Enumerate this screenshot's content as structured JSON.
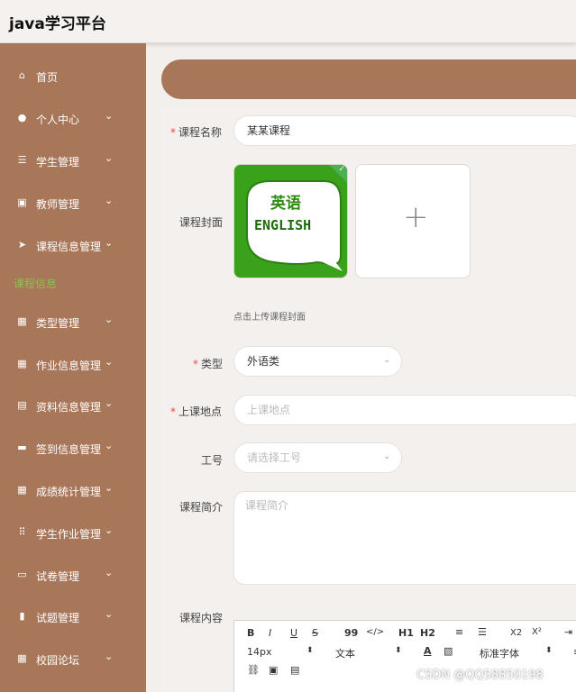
{
  "app": {
    "title": "java学习平台"
  },
  "sidebar": {
    "items": [
      {
        "label": "首页",
        "icon": "home-icon",
        "chevron": false
      },
      {
        "label": "个人中心",
        "icon": "user-icon",
        "chevron": true
      },
      {
        "label": "学生管理",
        "icon": "list-icon",
        "chevron": true
      },
      {
        "label": "教师管理",
        "icon": "image-icon",
        "chevron": true
      },
      {
        "label": "课程信息管理",
        "icon": "send-icon",
        "chevron": true
      },
      {
        "label": "类型管理",
        "icon": "grid-icon",
        "chevron": true
      },
      {
        "label": "作业信息管理",
        "icon": "grid-icon",
        "chevron": true
      },
      {
        "label": "资料信息管理",
        "icon": "clipboard-icon",
        "chevron": true
      },
      {
        "label": "签到信息管理",
        "icon": "ticket-icon",
        "chevron": true
      },
      {
        "label": "成绩统计管理",
        "icon": "grid-icon",
        "chevron": true
      },
      {
        "label": "学生作业管理",
        "icon": "apps-icon",
        "chevron": true
      },
      {
        "label": "试卷管理",
        "icon": "monitor-icon",
        "chevron": true
      },
      {
        "label": "试题管理",
        "icon": "bar-chart-icon",
        "chevron": true
      },
      {
        "label": "校园论坛",
        "icon": "grid-icon",
        "chevron": true
      }
    ],
    "active_submenu": "课程信息",
    "chevron_glyph": "⌄"
  },
  "form": {
    "course_name": {
      "label": "课程名称",
      "required": "*",
      "value": "某某课程"
    },
    "cover": {
      "label": "课程封面",
      "hint": "点击上传课程封面",
      "image_text_cn": "英语",
      "image_text_en": "ENGLISH",
      "upload_glyph": "+"
    },
    "type": {
      "label": "类型",
      "required": "*",
      "value": "外语类"
    },
    "location": {
      "label": "上课地点",
      "required": "*",
      "placeholder": "上课地点"
    },
    "job_no": {
      "label": "工号",
      "placeholder": "请选择工号"
    },
    "intro": {
      "label": "课程简介",
      "placeholder": "课程简介"
    },
    "content": {
      "label": "课程内容"
    }
  },
  "editor": {
    "row1": [
      "B",
      "I",
      "U",
      "S",
      "99",
      "</>",
      "H1",
      "H2",
      "list-ordered",
      "list-bullet",
      "X2",
      "X²",
      "indent"
    ],
    "font_size": "14px",
    "text_type": "文本",
    "font_family": "标准字体"
  },
  "watermark": "CSDN @QQ58850198",
  "colors": {
    "sidebar": "#a87658",
    "submenu_active": "#8bc34a",
    "required": "#e64c4c"
  }
}
